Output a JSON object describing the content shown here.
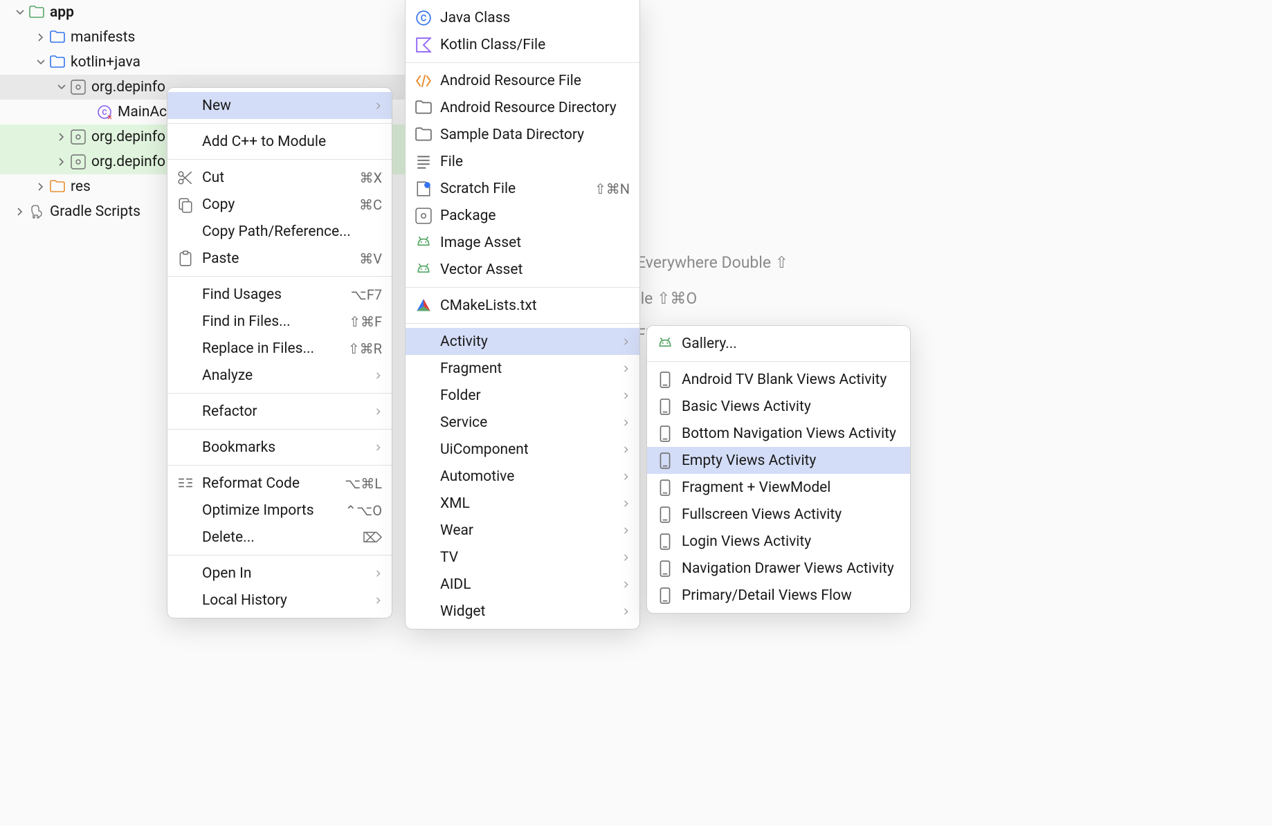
{
  "tree": {
    "app": "app",
    "manifests": "manifests",
    "kotlinjava": "kotlin+java",
    "pkg1": "org.depinfo",
    "mainact": "MainAct",
    "pkg2": "org.depinfo",
    "pkg3": "org.depinfo",
    "res": "res",
    "gradle": "Gradle Scripts"
  },
  "bg": {
    "l1": "Everywhere Double ⇧",
    "l2": "ile ⇧⌘O",
    "l3": "Files ⌘F"
  },
  "menu1": {
    "new": "New",
    "addcpp": "Add C++ to Module",
    "cut": "Cut",
    "cut_sc": "⌘X",
    "copy": "Copy",
    "copy_sc": "⌘C",
    "copypath": "Copy Path/Reference...",
    "paste": "Paste",
    "paste_sc": "⌘V",
    "findusages": "Find Usages",
    "findusages_sc": "⌥F7",
    "findinfiles": "Find in Files...",
    "findinfiles_sc": "⇧⌘F",
    "replaceinfiles": "Replace in Files...",
    "replaceinfiles_sc": "⇧⌘R",
    "analyze": "Analyze",
    "refactor": "Refactor",
    "bookmarks": "Bookmarks",
    "reformat": "Reformat Code",
    "reformat_sc": "⌥⌘L",
    "optimize": "Optimize Imports",
    "optimize_sc": "⌃⌥O",
    "delete": "Delete...",
    "delete_sc": "⌦",
    "openin": "Open In",
    "localhistory": "Local History"
  },
  "menu2": {
    "javaclass": "Java Class",
    "kotlinclass": "Kotlin Class/File",
    "andresfile": "Android Resource File",
    "andresdir": "Android Resource Directory",
    "sampledir": "Sample Data Directory",
    "file": "File",
    "scratch": "Scratch File",
    "scratch_sc": "⇧⌘N",
    "package": "Package",
    "imageasset": "Image Asset",
    "vectorasset": "Vector Asset",
    "cmake": "CMakeLists.txt",
    "activity": "Activity",
    "fragment": "Fragment",
    "folder": "Folder",
    "service": "Service",
    "uicomponent": "UiComponent",
    "automotive": "Automotive",
    "xml": "XML",
    "wear": "Wear",
    "tv": "TV",
    "aidl": "AIDL",
    "widget": "Widget"
  },
  "menu3": {
    "gallery": "Gallery...",
    "tvblank": "Android TV Blank Views Activity",
    "basic": "Basic Views Activity",
    "bottomnav": "Bottom Navigation Views Activity",
    "empty": "Empty Views Activity",
    "fragvm": "Fragment + ViewModel",
    "fullscreen": "Fullscreen Views Activity",
    "login": "Login Views Activity",
    "navdrawer": "Navigation Drawer Views Activity",
    "primarydetail": "Primary/Detail Views Flow"
  }
}
